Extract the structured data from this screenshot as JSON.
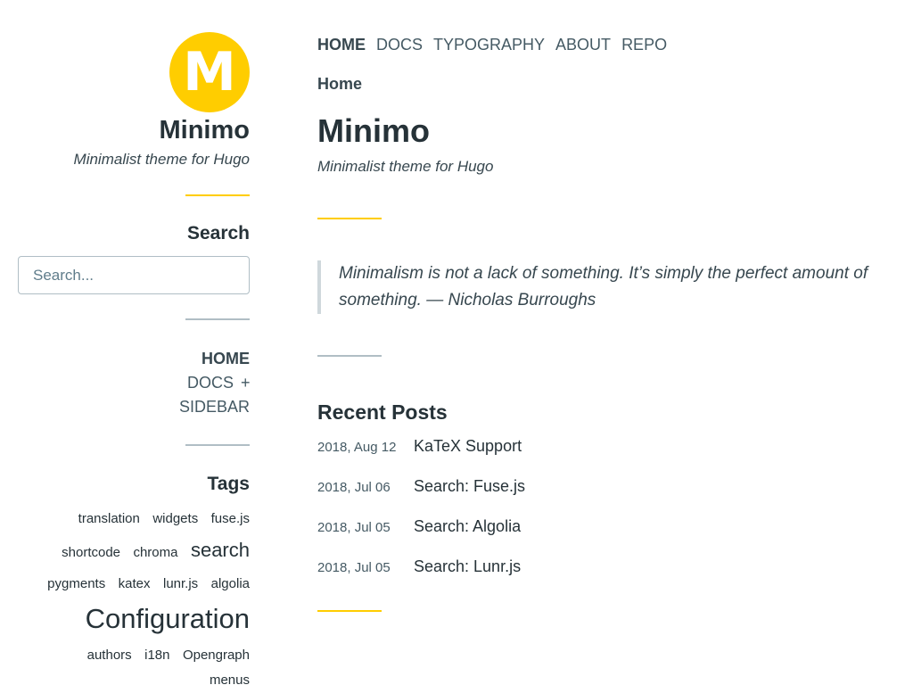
{
  "site": {
    "logo_letter": "M",
    "title": "Minimo",
    "description": "Minimalist theme for Hugo",
    "accent_color": "#ffcd00"
  },
  "sidebar": {
    "search": {
      "title": "Search",
      "placeholder": "Search..."
    },
    "menu": [
      {
        "label": "HOME",
        "active": true
      },
      {
        "label": "DOCS",
        "expand_symbol": "+"
      },
      {
        "label": "SIDEBAR"
      }
    ],
    "tags": {
      "title": "Tags",
      "items": [
        "translation",
        "widgets",
        "fuse.js",
        "shortcode",
        "chroma",
        "search",
        "pygments",
        "katex",
        "lunr.js",
        "algolia",
        "Configuration",
        "authors",
        "i18n",
        "Opengraph",
        "menus"
      ]
    }
  },
  "nav": {
    "items": [
      "HOME",
      "DOCS",
      "TYPOGRAPHY",
      "ABOUT",
      "REPO"
    ],
    "active": "HOME"
  },
  "main": {
    "breadcrumb": "Home",
    "title": "Minimo",
    "description": "Minimalist theme for Hugo",
    "quote": "Minimalism is not a lack of something. It’s simply the perfect amount of something. — Nicholas Burroughs",
    "recent_posts": {
      "title": "Recent Posts",
      "items": [
        {
          "date": "2018, Aug 12",
          "title": "KaTeX Support"
        },
        {
          "date": "2018, Jul 06",
          "title": "Search: Fuse.js"
        },
        {
          "date": "2018, Jul 05",
          "title": "Search: Algolia"
        },
        {
          "date": "2018, Jul 05",
          "title": "Search: Lunr.js"
        }
      ]
    }
  }
}
